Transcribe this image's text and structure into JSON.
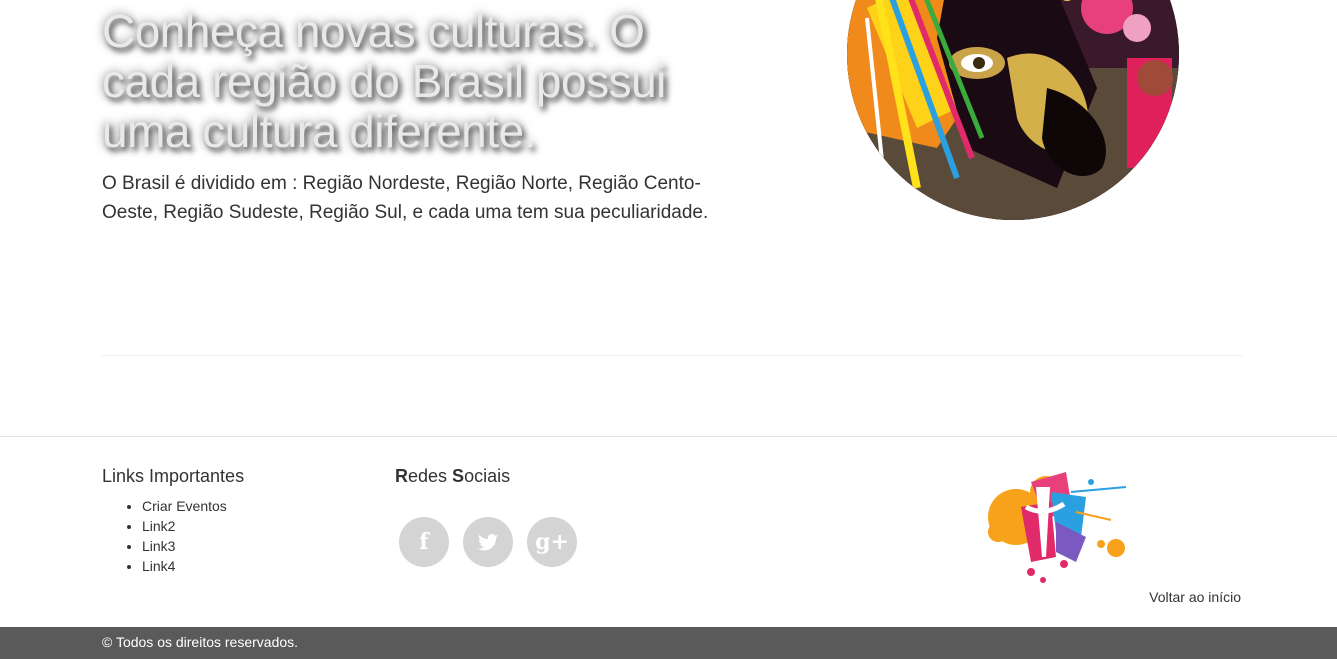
{
  "hero": {
    "title": "Conheça novas culturas. O cada região do Brasil possui uma cultura diferente.",
    "text": "O Brasil é dividido em : Região Nordeste, Região Norte, Região Cento-Oeste, Região Sudeste, Região Sul, e cada uma tem sua peculiaridade."
  },
  "footer": {
    "links_title": "Links Importantes",
    "links": [
      "Criar Eventos",
      "Link2",
      "Link3",
      "Link4"
    ],
    "social_title_r": "R",
    "social_title_1": "edes ",
    "social_title_s": "S",
    "social_title_2": "ociais",
    "social": [
      {
        "icon": "facebook-icon",
        "glyph": "f"
      },
      {
        "icon": "twitter-icon",
        "glyph": ""
      },
      {
        "icon": "google-plus-icon",
        "glyph": "g+"
      }
    ],
    "back_to_top": "Voltar ao início",
    "copyright": "© Todos os direitos reservados."
  },
  "colors": {
    "bottom_bar": "#5a5a5a",
    "social_bg": "#d4d4d4"
  }
}
